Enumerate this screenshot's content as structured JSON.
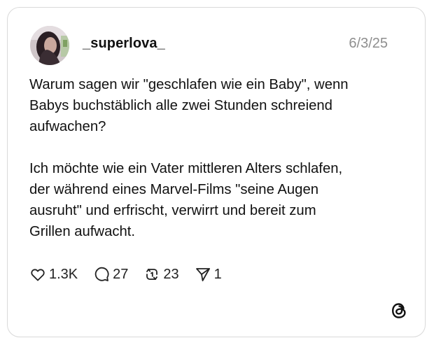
{
  "post": {
    "username": "_superlova_",
    "date": "6/3/25",
    "paragraphs": [
      "Warum sagen wir \"geschlafen wie ein Baby\", wenn\nBabys buchstäblich alle zwei Stunden schreiend\naufwachen?",
      "Ich möchte wie ein Vater mittleren Alters schlafen,\nder während eines Marvel-Films \"seine Augen\nausruht\" und erfrischt, verwirrt und bereit zum\nGrillen aufwacht."
    ]
  },
  "actions": {
    "likes": "1.3K",
    "replies": "27",
    "reposts": "23",
    "shares": "1"
  },
  "icons": {
    "like": "heart-icon",
    "reply": "speech-bubble-icon",
    "repost": "repost-icon",
    "share": "paper-plane-icon",
    "brand": "threads-logo-icon"
  },
  "colors": {
    "text": "#111111",
    "muted": "#8e8e8e",
    "border": "#d9d9d9"
  }
}
